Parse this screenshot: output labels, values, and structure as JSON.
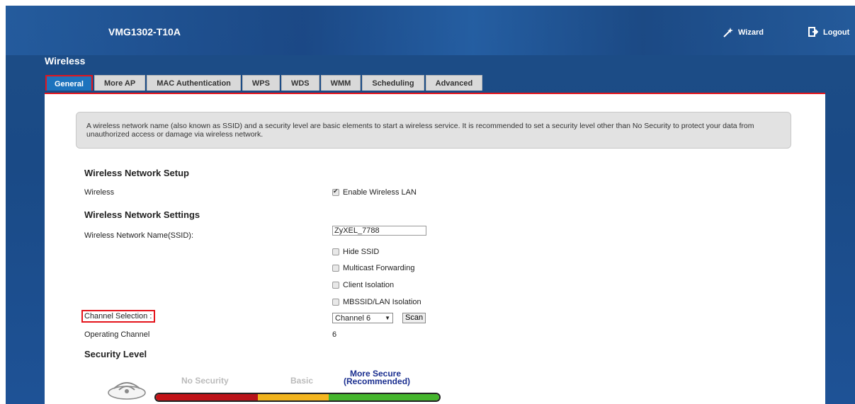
{
  "header": {
    "model": "VMG1302-T10A",
    "wizard_label": "Wizard",
    "logout_label": "Logout"
  },
  "section_title": "Wireless",
  "tabs": [
    {
      "label": "General",
      "active": true
    },
    {
      "label": "More AP"
    },
    {
      "label": "MAC Authentication"
    },
    {
      "label": "WPS"
    },
    {
      "label": "WDS"
    },
    {
      "label": "WMM"
    },
    {
      "label": "Scheduling"
    },
    {
      "label": "Advanced"
    }
  ],
  "info_text": "A wireless network name (also known as SSID) and a security level are basic elements to start a wireless service. It is recommended to set a security level other than No Security to protect your data from unauthorized access or damage via wireless network.",
  "setup": {
    "heading": "Wireless Network Setup",
    "wireless_label": "Wireless",
    "enable_label": "Enable Wireless LAN",
    "enable_checked": true
  },
  "settings": {
    "heading": "Wireless Network Settings",
    "ssid_label": "Wireless Network Name(SSID):",
    "ssid_value": "ZyXEL_7788",
    "hide_ssid": "Hide SSID",
    "multicast": "Multicast Forwarding",
    "client_isolation": "Client Isolation",
    "mbssid_isolation": "MBSSID/LAN Isolation",
    "channel_label": "Channel Selection :",
    "channel_value": "Channel 6",
    "scan_label": "Scan",
    "operating_label": "Operating Channel",
    "operating_value": "6"
  },
  "security": {
    "heading": "Security Level",
    "levels": {
      "none": "No Security",
      "basic": "Basic",
      "more_line1": "More Secure",
      "more_line2": "(Recommended)"
    }
  },
  "colors": {
    "accent_red": "#e4141b",
    "tab_active": "#1d73bd",
    "header_blue": "#1d4d86"
  }
}
